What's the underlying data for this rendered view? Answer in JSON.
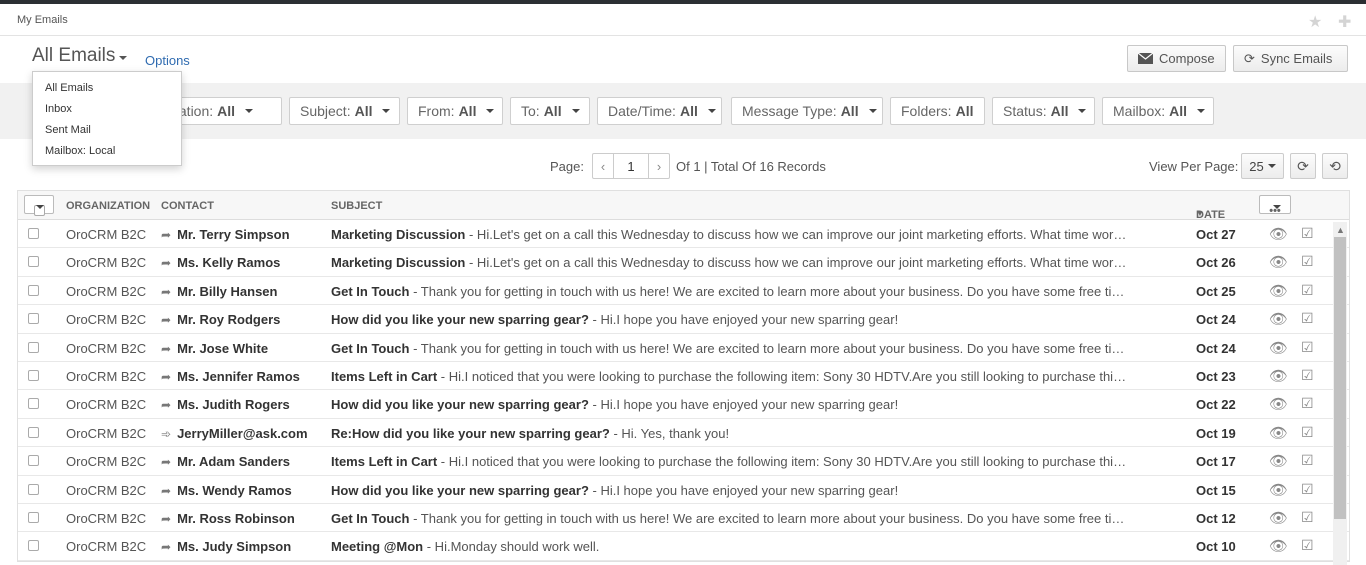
{
  "breadcrumb": "My Emails",
  "title": "All Emails",
  "options_label": "Options",
  "buttons": {
    "compose": "Compose",
    "sync": "Sync Emails"
  },
  "menu": [
    "All Emails",
    "Inbox",
    "Sent Mail",
    "Mailbox: Local"
  ],
  "filters": [
    {
      "label": "Organization:",
      "value": "All",
      "visible_label": "nization:"
    },
    {
      "label": "Subject:",
      "value": "All"
    },
    {
      "label": "From:",
      "value": "All"
    },
    {
      "label": "To:",
      "value": "All"
    },
    {
      "label": "Date/Time:",
      "value": "All"
    },
    {
      "label": "Message Type:",
      "value": "All"
    },
    {
      "label": "Folders:",
      "value": "All"
    },
    {
      "label": "Status:",
      "value": "All"
    },
    {
      "label": "Mailbox:",
      "value": "All"
    }
  ],
  "pager": {
    "page_label": "Page:",
    "current": "1",
    "of_text": "Of 1 | Total Of 16 Records",
    "view_per_page_label": "View Per Page:",
    "per_page": "25"
  },
  "columns": {
    "organization": "ORGANIZATION",
    "contact": "CONTACT",
    "subject": "SUBJECT",
    "date": "DATE"
  },
  "rows": [
    {
      "org": "OroCRM B2C",
      "dir": "out",
      "contact": "Mr. Terry Simpson",
      "subject": "Marketing Discussion",
      "body": " - Hi.Let's get on a call this Wednesday to discuss how we can improve our joint marketing efforts. What time works b...",
      "date": "Oct 27"
    },
    {
      "org": "OroCRM B2C",
      "dir": "out",
      "contact": "Ms. Kelly Ramos",
      "subject": "Marketing Discussion",
      "body": " - Hi.Let's get on a call this Wednesday to discuss how we can improve our joint marketing efforts. What time works b...",
      "date": "Oct 26"
    },
    {
      "org": "OroCRM B2C",
      "dir": "out",
      "contact": "Mr. Billy Hansen",
      "subject": "Get In Touch",
      "body": " - Thank you for getting in touch with us here! We are excited to learn more about your business. Do you have some free time ...",
      "date": "Oct 25"
    },
    {
      "org": "OroCRM B2C",
      "dir": "out",
      "contact": "Mr. Roy Rodgers",
      "subject": "How did you like your new sparring gear?",
      "body": " - Hi.I hope you have enjoyed your new sparring gear!",
      "date": "Oct 24"
    },
    {
      "org": "OroCRM B2C",
      "dir": "out",
      "contact": "Mr. Jose White",
      "subject": "Get In Touch",
      "body": " - Thank you for getting in touch with us here! We are excited to learn more about your business. Do you have some free time ...",
      "date": "Oct 24"
    },
    {
      "org": "OroCRM B2C",
      "dir": "out",
      "contact": "Ms. Jennifer Ramos",
      "subject": "Items Left in Cart",
      "body": " - Hi.I noticed that you were looking to purchase the following item: Sony 30 HDTV.Are you still looking to purchase this pr...",
      "date": "Oct 23"
    },
    {
      "org": "OroCRM B2C",
      "dir": "out",
      "contact": "Ms. Judith Rogers",
      "subject": "How did you like your new sparring gear?",
      "body": " - Hi.I hope you have enjoyed your new sparring gear!",
      "date": "Oct 22"
    },
    {
      "org": "OroCRM B2C",
      "dir": "in",
      "contact": "JerryMiller@ask.com",
      "subject": "Re:How did you like your new sparring gear?",
      "body": " - Hi. Yes, thank you!",
      "date": "Oct 19"
    },
    {
      "org": "OroCRM B2C",
      "dir": "out",
      "contact": "Mr. Adam Sanders",
      "subject": "Items Left in Cart",
      "body": " - Hi.I noticed that you were looking to purchase the following item: Sony 30 HDTV.Are you still looking to purchase this pr...",
      "date": "Oct 17"
    },
    {
      "org": "OroCRM B2C",
      "dir": "out",
      "contact": "Ms. Wendy Ramos",
      "subject": "How did you like your new sparring gear?",
      "body": " - Hi.I hope you have enjoyed your new sparring gear!",
      "date": "Oct 15"
    },
    {
      "org": "OroCRM B2C",
      "dir": "out",
      "contact": "Mr. Ross Robinson",
      "subject": "Get In Touch",
      "body": " - Thank you for getting in touch with us here! We are excited to learn more about your business. Do you have some free time ...",
      "date": "Oct 12"
    },
    {
      "org": "OroCRM B2C",
      "dir": "out",
      "contact": "Ms. Judy Simpson",
      "subject": "Meeting @Mon",
      "body": " - Hi.Monday should work well.",
      "date": "Oct 10"
    }
  ]
}
